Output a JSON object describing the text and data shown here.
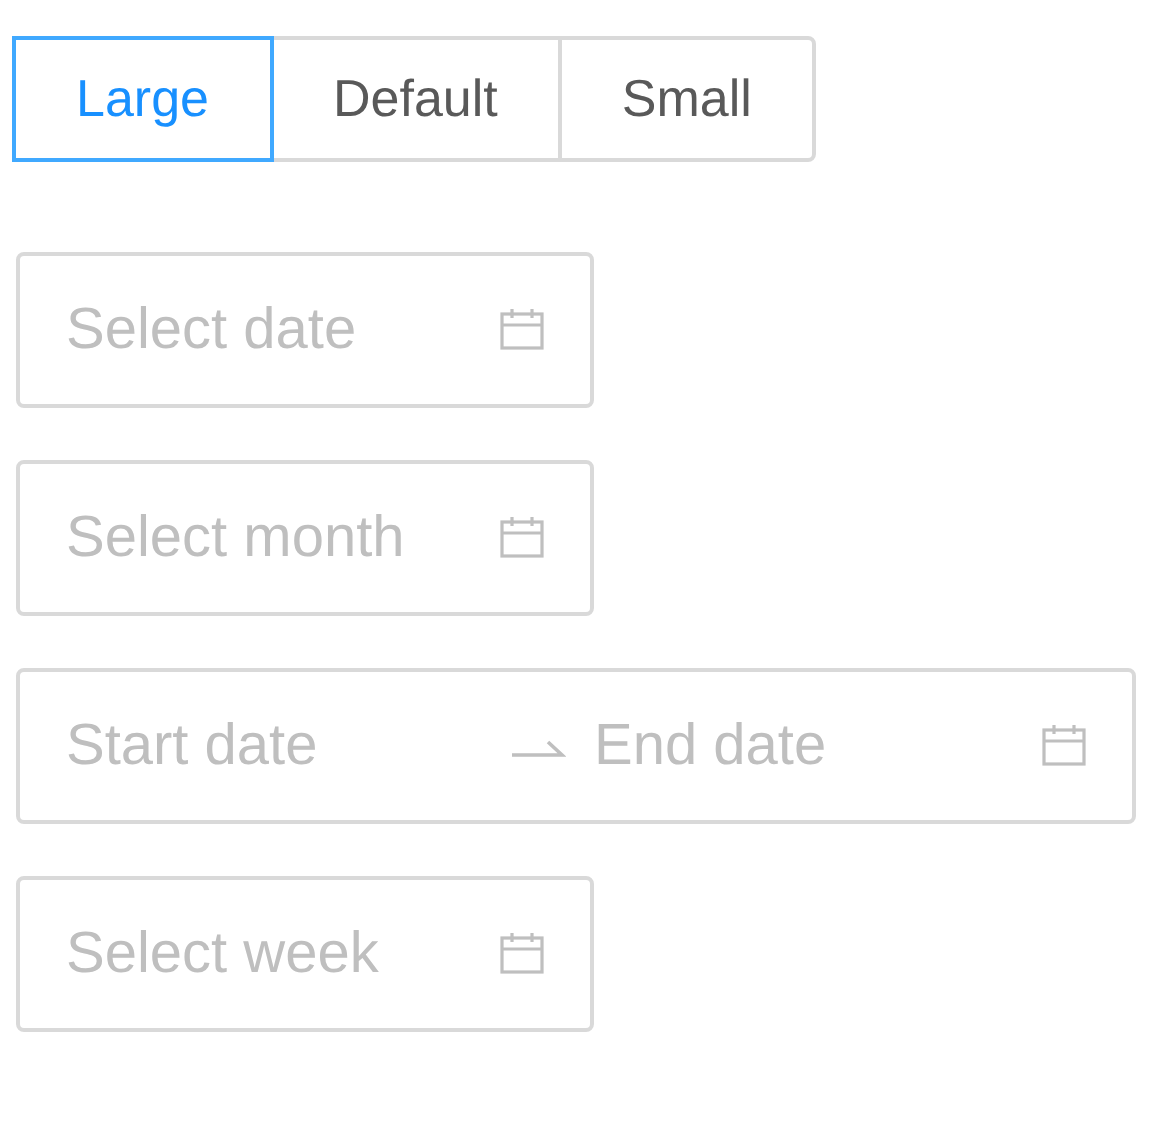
{
  "size_options": [
    {
      "label": "Large",
      "selected": true
    },
    {
      "label": "Default",
      "selected": false
    },
    {
      "label": "Small",
      "selected": false
    }
  ],
  "pickers": [
    {
      "kind": "single",
      "placeholder": "Select date"
    },
    {
      "kind": "single",
      "placeholder": "Select month"
    },
    {
      "kind": "range",
      "start_placeholder": "Start date",
      "end_placeholder": "End date"
    },
    {
      "kind": "single",
      "placeholder": "Select week"
    }
  ]
}
